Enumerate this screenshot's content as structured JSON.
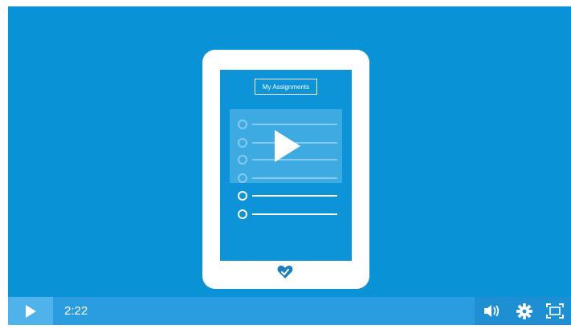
{
  "video": {
    "illustration_title": "My Assignments",
    "time": "2:22"
  },
  "icons": {
    "play": "play-icon",
    "big_play": "play-overlay-icon",
    "volume": "volume-icon",
    "settings": "gear-icon",
    "fullscreen": "fullscreen-icon",
    "logo": "heart-icon"
  },
  "colors": {
    "background": "#0a92d6",
    "control_bar": "#2a9de0",
    "play_button": "#4fb2ea",
    "foreground": "#ffffff"
  }
}
